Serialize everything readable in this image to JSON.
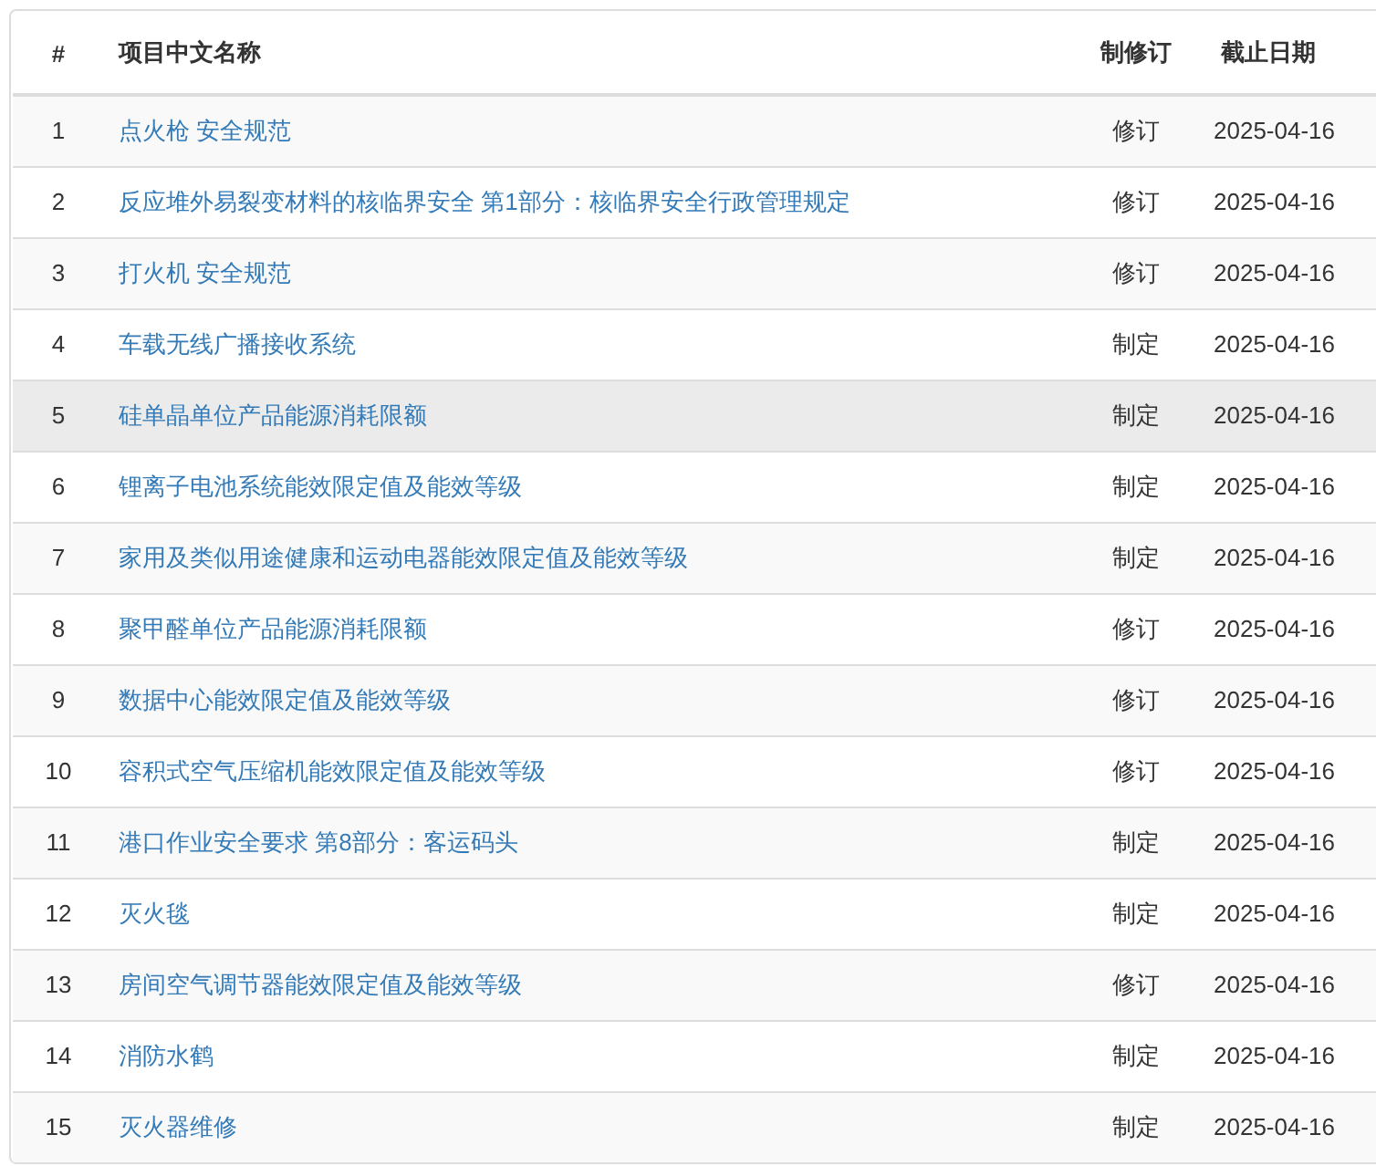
{
  "table": {
    "columns": [
      "#",
      "项目中文名称",
      "制修订",
      "截止日期"
    ],
    "rows": [
      {
        "index": "1",
        "name": "点火枪 安全规范",
        "type": "修订",
        "deadline": "2025-04-16",
        "highlighted": false
      },
      {
        "index": "2",
        "name": "反应堆外易裂变材料的核临界安全 第1部分：核临界安全行政管理规定",
        "type": "修订",
        "deadline": "2025-04-16",
        "highlighted": false
      },
      {
        "index": "3",
        "name": "打火机 安全规范",
        "type": "修订",
        "deadline": "2025-04-16",
        "highlighted": false
      },
      {
        "index": "4",
        "name": "车载无线广播接收系统",
        "type": "制定",
        "deadline": "2025-04-16",
        "highlighted": false
      },
      {
        "index": "5",
        "name": "硅单晶单位产品能源消耗限额",
        "type": "制定",
        "deadline": "2025-04-16",
        "highlighted": true
      },
      {
        "index": "6",
        "name": "锂离子电池系统能效限定值及能效等级",
        "type": "制定",
        "deadline": "2025-04-16",
        "highlighted": false
      },
      {
        "index": "7",
        "name": "家用及类似用途健康和运动电器能效限定值及能效等级",
        "type": "制定",
        "deadline": "2025-04-16",
        "highlighted": false
      },
      {
        "index": "8",
        "name": "聚甲醛单位产品能源消耗限额",
        "type": "修订",
        "deadline": "2025-04-16",
        "highlighted": false
      },
      {
        "index": "9",
        "name": "数据中心能效限定值及能效等级",
        "type": "修订",
        "deadline": "2025-04-16",
        "highlighted": false
      },
      {
        "index": "10",
        "name": "容积式空气压缩机能效限定值及能效等级",
        "type": "修订",
        "deadline": "2025-04-16",
        "highlighted": false
      },
      {
        "index": "11",
        "name": "港口作业安全要求 第8部分：客运码头",
        "type": "制定",
        "deadline": "2025-04-16",
        "highlighted": false
      },
      {
        "index": "12",
        "name": "灭火毯",
        "type": "制定",
        "deadline": "2025-04-16",
        "highlighted": false
      },
      {
        "index": "13",
        "name": "房间空气调节器能效限定值及能效等级",
        "type": "修订",
        "deadline": "2025-04-16",
        "highlighted": false
      },
      {
        "index": "14",
        "name": "消防水鹤",
        "type": "制定",
        "deadline": "2025-04-16",
        "highlighted": false
      },
      {
        "index": "15",
        "name": "灭火器维修",
        "type": "制定",
        "deadline": "2025-04-16",
        "highlighted": false
      }
    ]
  }
}
